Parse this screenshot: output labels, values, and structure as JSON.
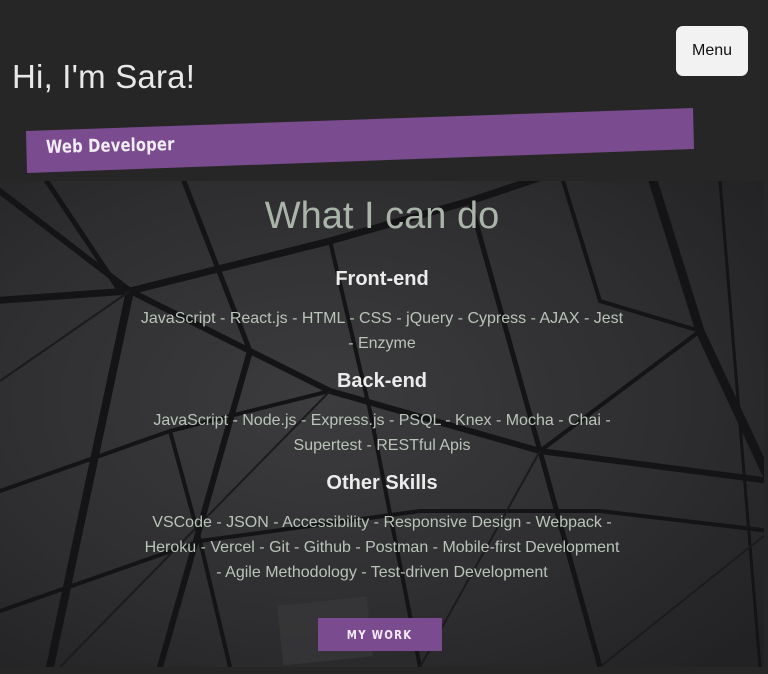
{
  "header": {
    "greeting": "Hi, I'm Sara!",
    "role": "Web Developer",
    "menu_label": "Menu"
  },
  "skills": {
    "title": "What I can do",
    "categories": [
      {
        "name": "Front-end",
        "items": "JavaScript - React.js - HTML - CSS - jQuery - Cypress - AJAX - Jest - Enzyme"
      },
      {
        "name": "Back-end",
        "items": "JavaScript - Node.js - Express.js - PSQL - Knex - Mocha - Chai - Supertest - RESTful Apis"
      },
      {
        "name": "Other Skills",
        "items": "VSCode - JSON - Accessibility - Responsive Design - Webpack - Heroku - Vercel - Git - Github - Postman - Mobile-first Development - Agile Methodology - Test-driven Development"
      }
    ],
    "cta_label": "MY WORK"
  },
  "colors": {
    "page_bg": "#262626",
    "accent_purple": "#7a4b8f",
    "heading_sage": "#a9b5a9",
    "text_sage": "#b9c4b9",
    "menu_bg": "#f2f2f2"
  },
  "icons": {
    "background": "glass-roof-structure-image"
  }
}
